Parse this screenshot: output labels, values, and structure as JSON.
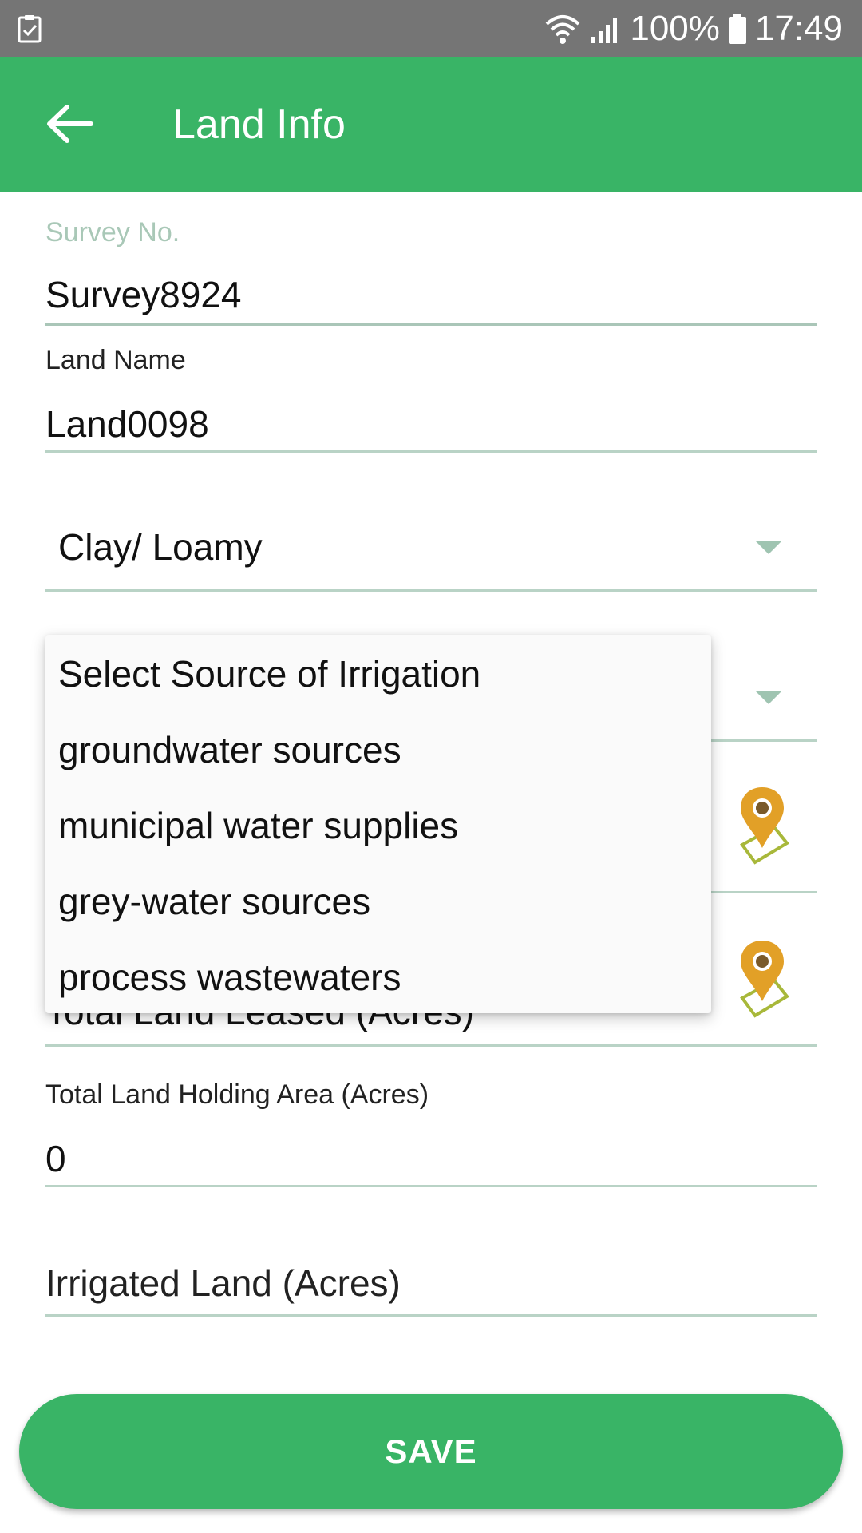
{
  "status_bar": {
    "battery": "100%",
    "time": "17:49"
  },
  "app_bar": {
    "title": "Land Info"
  },
  "form": {
    "survey_no": {
      "label": "Survey No.",
      "value": "Survey8924"
    },
    "land_name": {
      "label": "Land Name",
      "value": "Land0098"
    },
    "soil_type": {
      "selected": "Clay/ Loamy"
    },
    "total_land_leased": {
      "value": "Total Land Leased (Acres)"
    },
    "total_land_holding": {
      "label": "Total Land Holding Area (Acres)",
      "value": "0"
    },
    "irrigated_land": {
      "placeholder": "Irrigated Land (Acres)"
    }
  },
  "irrigation_dropdown": {
    "options": [
      "Select Source of Irrigation",
      "groundwater sources",
      "municipal water supplies",
      "grey-water sources",
      "process wastewaters"
    ]
  },
  "actions": {
    "save_label": "SAVE"
  },
  "colors": {
    "primary": "#39b466",
    "status_bar": "#757575",
    "field_line": "#b9d3c6",
    "pin": "#e2a027",
    "pin_outline": "#a8b83a"
  },
  "icons": [
    "task-check-icon",
    "wifi-icon",
    "signal-icon",
    "battery-icon",
    "back-arrow-icon",
    "location-pin-icon",
    "chevron-down-icon"
  ]
}
